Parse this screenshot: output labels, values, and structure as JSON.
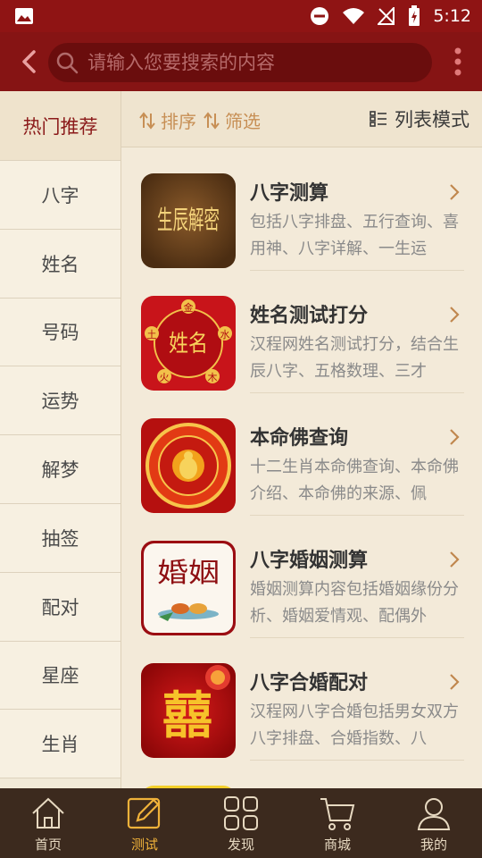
{
  "status_bar": {
    "time": "5:12"
  },
  "search": {
    "placeholder": "请输入您要搜索的内容"
  },
  "sidebar": {
    "items": [
      {
        "label": "热门推荐"
      },
      {
        "label": "八字"
      },
      {
        "label": "姓名"
      },
      {
        "label": "号码"
      },
      {
        "label": "运势"
      },
      {
        "label": "解梦"
      },
      {
        "label": "抽签"
      },
      {
        "label": "配对"
      },
      {
        "label": "星座"
      },
      {
        "label": "生肖"
      }
    ]
  },
  "filter_bar": {
    "sort_label": "排序",
    "filter_label": "筛选",
    "list_mode_label": "列表模式"
  },
  "list": [
    {
      "title": "八字测算",
      "desc": "包括八字排盘、五行查询、喜用神、八字详解、一生运",
      "thumb_text": "生辰解密"
    },
    {
      "title": "姓名测试打分",
      "desc": "汉程网姓名测试打分，结合生辰八字、五格数理、三才",
      "thumb_text": "姓名",
      "thumb_marks": [
        "金",
        "水",
        "木",
        "火",
        "土"
      ]
    },
    {
      "title": "本命佛查询",
      "desc": "十二生肖本命佛查询、本命佛介绍、本命佛的来源、佩"
    },
    {
      "title": "八字婚姻测算",
      "desc": "婚姻测算内容包括婚姻缘份分析、婚姻爱情观、配偶外",
      "thumb_text": "婚姻"
    },
    {
      "title": "八字合婚配对",
      "desc": "汉程网八字合婚包括男女双方八字排盘、合婚指数、八",
      "thumb_text": "囍"
    }
  ],
  "tabbar": {
    "tabs": [
      {
        "label": "首页"
      },
      {
        "label": "测试"
      },
      {
        "label": "发现"
      },
      {
        "label": "商城"
      },
      {
        "label": "我的"
      }
    ]
  },
  "colors": {
    "header": "#861414",
    "accent": "#f0b23a",
    "sidebar_active_text": "#8b1a1a",
    "tabbar": "#3c2a1e"
  }
}
